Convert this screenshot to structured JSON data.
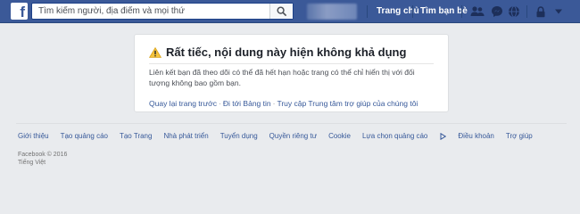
{
  "header": {
    "logo_letter": "f",
    "search_placeholder": "Tìm kiếm người, địa điểm và mọi thứ",
    "nav": {
      "home": "Trang chủ",
      "find_friends": "Tìm bạn bè"
    },
    "icons": [
      "friend-requests-icon",
      "messages-icon",
      "notifications-icon",
      "privacy-shortcuts-icon",
      "account-menu-icon"
    ],
    "brand_color": "#3b5998"
  },
  "error_card": {
    "title": "Rất tiếc, nội dung này hiện không khả dụng",
    "message": "Liên kết bạn đã theo dõi có thể đã hết hạn hoặc trang có thể chỉ hiển thị với đối tượng không bao gồm bạn.",
    "links": [
      "Quay lại trang trước",
      "Đi tới Bảng tin",
      "Truy cập Trung tâm trợ giúp của chúng tôi"
    ],
    "separator": "·"
  },
  "footer": {
    "links": [
      "Giới thiệu",
      "Tạo quảng cáo",
      "Tạo Trang",
      "Nhà phát triển",
      "Tuyển dụng",
      "Quyền riêng tư",
      "Cookie",
      "Lựa chọn quảng cáo",
      "Điều khoản",
      "Trợ giúp"
    ],
    "copyright": "Facebook © 2016",
    "language": "Tiếng Việt"
  }
}
